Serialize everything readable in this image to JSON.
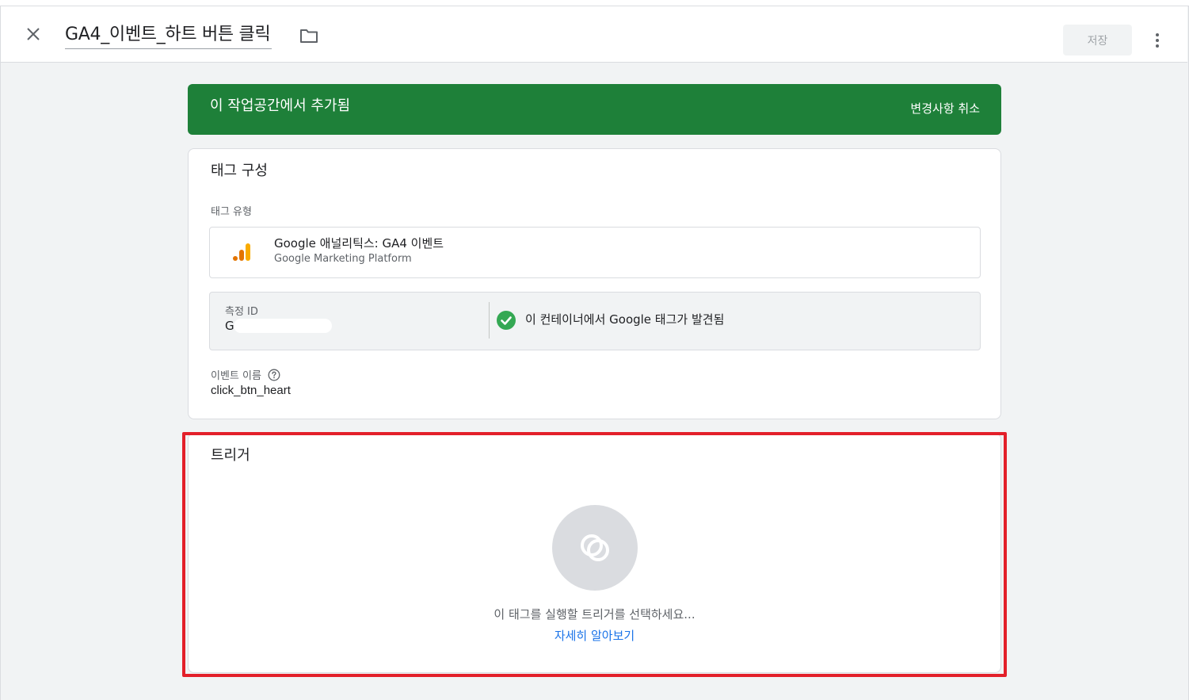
{
  "header": {
    "title": "GA4_이벤트_하트 버튼 클릭",
    "save_label": "저장"
  },
  "banner": {
    "text": "이 작업공간에서 추가됨",
    "action_label": "변경사항 취소",
    "color": "#1e8039"
  },
  "tag_config": {
    "title": "태그 구성",
    "tag_type_label": "태그 유형",
    "tag_type": {
      "name": "Google 애널리틱스: GA4 이벤트",
      "platform": "Google Marketing Platform",
      "icon": "google-analytics-icon"
    },
    "measurement": {
      "label": "측정 ID",
      "value": "G",
      "status_text": "이 컨테이너에서 Google 태그가 발견됨",
      "status_icon": "check-circle-icon",
      "status_color": "#34a853"
    },
    "event_name_label": "이벤트 이름",
    "event_name": "click_btn_heart"
  },
  "trigger": {
    "title": "트리거",
    "hint": "이 태그를 실행할 트리거를 선택하세요...",
    "learn_more": "자세히 알아보기",
    "highlight_color": "#e3202a"
  }
}
